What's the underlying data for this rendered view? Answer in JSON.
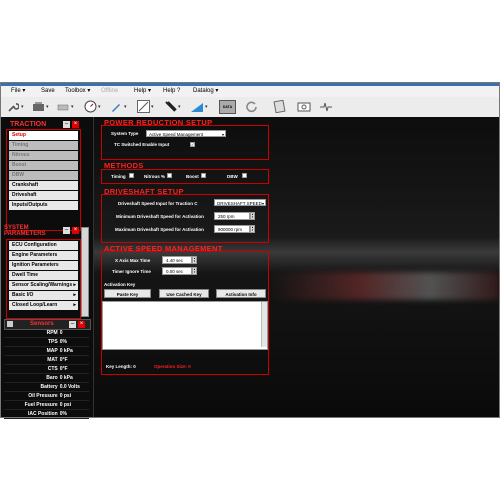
{
  "menu": {
    "items": [
      {
        "label": "File",
        "arrow": "▾"
      },
      {
        "label": "Save",
        "arrow": ""
      },
      {
        "label": "Toolbox",
        "arrow": "▾"
      },
      {
        "label": "Offline",
        "arrow": ""
      },
      {
        "label": "Help",
        "arrow": "▾"
      },
      {
        "label": "Help ?",
        "arrow": ""
      },
      {
        "label": "Datalog",
        "arrow": "▾"
      }
    ]
  },
  "toolbar": {
    "icons": [
      "wrench-icon",
      "ecu-icon",
      "connect-icon",
      "gauge-icon",
      "pen-icon",
      "graph-icon",
      "tool-icon",
      "ramp-icon",
      "data-icon",
      "refresh-icon",
      "print-icon",
      "display-icon",
      "pulse-icon"
    ],
    "data_icon_label": "DATA"
  },
  "sidebar": {
    "traction_title": "TRACTION",
    "traction_items": [
      {
        "label": "Setup",
        "state": "selected"
      },
      {
        "label": "Timing",
        "state": "disabled"
      },
      {
        "label": "Nitrous",
        "state": "disabled"
      },
      {
        "label": "Boost",
        "state": "disabled"
      },
      {
        "label": "DBW",
        "state": "disabled"
      },
      {
        "label": "Crankshaft",
        "state": "normal"
      },
      {
        "label": "Driveshaft",
        "state": "normal"
      },
      {
        "label": "Inputs/Outputs",
        "state": "normal"
      }
    ],
    "system_title_1": "SYSTEM",
    "system_title_2": "PARAMETERS",
    "system_items": [
      {
        "label": "ECU Configuration",
        "arrow": ""
      },
      {
        "label": "Engine Parameters",
        "arrow": ""
      },
      {
        "label": "Ignition Parameters",
        "arrow": ""
      },
      {
        "label": "Dwell Time",
        "arrow": ""
      },
      {
        "label": "Sensor Scaling/Warnings",
        "arrow": "▸"
      },
      {
        "label": "Basic I/O",
        "arrow": "▸"
      },
      {
        "label": "Closed Loop/Learn",
        "arrow": "▸"
      }
    ],
    "sensors_title": "Sensors",
    "sensors": [
      {
        "name": "RPM",
        "value": "0"
      },
      {
        "name": "TPS",
        "value": "0%"
      },
      {
        "name": "MAP",
        "value": "0 kPa"
      },
      {
        "name": "MAT",
        "value": "0°F"
      },
      {
        "name": "CTS",
        "value": "0°F"
      },
      {
        "name": "Baro",
        "value": "0 kPa"
      },
      {
        "name": "Battery",
        "value": "0.0 Volts"
      },
      {
        "name": "Oil Pressure",
        "value": "0 psi"
      },
      {
        "name": "Fuel Pressure",
        "value": "0 psi"
      },
      {
        "name": "IAC Position",
        "value": "0%"
      }
    ]
  },
  "power": {
    "title": "POWER REDUCTION SETUP",
    "system_type_label": "System Type",
    "system_type_value": "Active Speed Management",
    "tc_switched_label": "TC Switched Enable Input",
    "tc_switched_checked": true
  },
  "methods": {
    "title": "METHODS",
    "items": [
      {
        "label": "Timing",
        "checked": false
      },
      {
        "label": "Nitrous %",
        "checked": false
      },
      {
        "label": "Boost",
        "checked": false
      },
      {
        "label": "DBW",
        "checked": false
      }
    ]
  },
  "driveshaft": {
    "title": "DRIVESHAFT SETUP",
    "input_label": "Driveshaft Speed Input for Traction C",
    "input_value": "DRIVESHAFT SPEED",
    "min_label": "Minimum Driveshaft Speed for Activation",
    "min_value": "250 rpm",
    "max_label": "Maximum Driveshaft Speed for Activation",
    "max_value": "900000 rpm"
  },
  "asm": {
    "title": "ACTIVE SPEED MANAGEMENT",
    "x_axis_label": "X Axis Max Time",
    "x_axis_value": "4.40 sec",
    "timer_label": "Timer Ignore Time",
    "timer_value": "0.00 sec",
    "activation_key_label": "Activation Key",
    "paste_key": "Paste Key",
    "use_cached_key": "Use Cached Key",
    "activation_info": "Activation Info",
    "key_length_label": "Key Length: 0",
    "operation_size_label": "Operation Size: 0"
  },
  "colors": {
    "accent_red": "#cc0000",
    "background": "#000000"
  }
}
